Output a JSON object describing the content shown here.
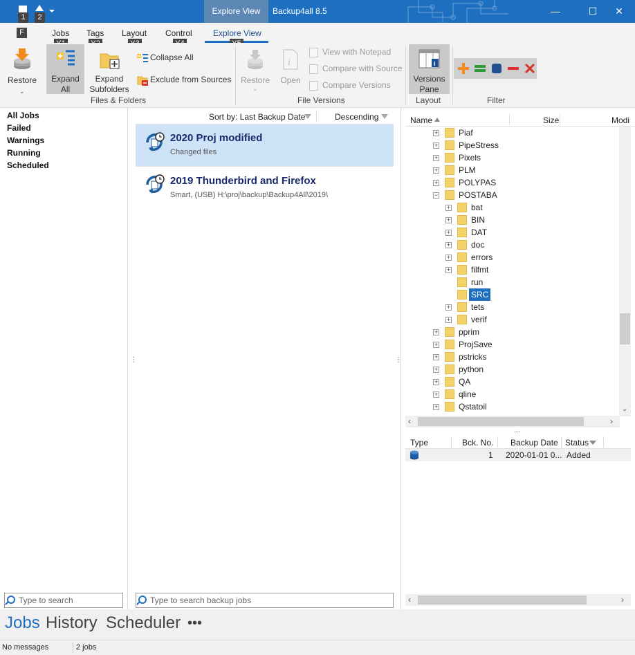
{
  "window": {
    "context_tab": "Explore View",
    "title": "Backup4all 8.5",
    "minimize": "—",
    "maximize": "☐",
    "close": "✕"
  },
  "quick_access": {
    "keytips": [
      "1",
      "2"
    ]
  },
  "tabs": [
    {
      "label": "F",
      "keytip": ""
    },
    {
      "label": "Jobs",
      "keytip": "Y1"
    },
    {
      "label": "Tags",
      "keytip": "Y2"
    },
    {
      "label": "Layout",
      "keytip": "Y3"
    },
    {
      "label": "Control",
      "keytip": "Y4"
    },
    {
      "label": "Explore View",
      "keytip": "Y5"
    }
  ],
  "ribbon": {
    "restore": "Restore",
    "expand_all_1": "Expand",
    "expand_all_2": "All",
    "expand_subfolders_1": "Expand",
    "expand_subfolders_2": "Subfolders",
    "collapse_all": "Collapse All",
    "exclude_from_sources": "Exclude from Sources",
    "group_files_folders": "Files & Folders",
    "fv_restore": "Restore",
    "fv_open": "Open",
    "view_notepad": "View with Notepad",
    "compare_source": "Compare with Source",
    "compare_versions": "Compare Versions",
    "group_file_versions": "File Versions",
    "versions_pane_1": "Versions",
    "versions_pane_2": "Pane",
    "group_layout": "Layout",
    "group_filter": "Filter"
  },
  "nav": {
    "items": [
      "All Jobs",
      "Failed",
      "Warnings",
      "Running",
      "Scheduled"
    ],
    "search_placeholder": "Type to search"
  },
  "jobs": {
    "sort_label": "Sort by: Last Backup Date",
    "order_label": "Descending",
    "list": [
      {
        "title": "2020 Proj modified",
        "subtitle": "Changed files"
      },
      {
        "title": "2019 Thunderbird and Firefox",
        "subtitle": "Smart, (USB) H:\\proj\\backup\\Backup4All\\2019\\"
      }
    ],
    "search_placeholder": "Type to search backup jobs"
  },
  "tree": {
    "columns": [
      "Name",
      "Size",
      "Modi"
    ],
    "rows": [
      {
        "label": "Piaf",
        "level": 0,
        "expander": "+"
      },
      {
        "label": "PipeStress",
        "level": 0,
        "expander": "+"
      },
      {
        "label": "Pixels",
        "level": 0,
        "expander": "+"
      },
      {
        "label": "PLM",
        "level": 0,
        "expander": "+"
      },
      {
        "label": "POLYPAS",
        "level": 0,
        "expander": "+"
      },
      {
        "label": "POSTABA",
        "level": 0,
        "expander": "−"
      },
      {
        "label": "bat",
        "level": 1,
        "expander": "+"
      },
      {
        "label": "BIN",
        "level": 1,
        "expander": "+"
      },
      {
        "label": "DAT",
        "level": 1,
        "expander": "+"
      },
      {
        "label": "doc",
        "level": 1,
        "expander": "+"
      },
      {
        "label": "errors",
        "level": 1,
        "expander": "+"
      },
      {
        "label": "filfmt",
        "level": 1,
        "expander": "+"
      },
      {
        "label": "run",
        "level": 1,
        "expander": ""
      },
      {
        "label": "SRC",
        "level": 1,
        "expander": "",
        "selected": true
      },
      {
        "label": "tets",
        "level": 1,
        "expander": "+"
      },
      {
        "label": "verif",
        "level": 1,
        "expander": "+"
      },
      {
        "label": "pprim",
        "level": 0,
        "expander": "+"
      },
      {
        "label": "ProjSave",
        "level": 0,
        "expander": "+"
      },
      {
        "label": "pstricks",
        "level": 0,
        "expander": "+"
      },
      {
        "label": "python",
        "level": 0,
        "expander": "+"
      },
      {
        "label": "QA",
        "level": 0,
        "expander": "+"
      },
      {
        "label": "qline",
        "level": 0,
        "expander": "+"
      },
      {
        "label": "Qstatoil",
        "level": 0,
        "expander": "+"
      }
    ]
  },
  "versions": {
    "splitter": "...",
    "columns": [
      "Type",
      "Bck. No.",
      "Backup Date",
      "Status"
    ],
    "rows": [
      {
        "bck_no": "1",
        "date": "2020-01-01 0...",
        "status": "Added"
      }
    ]
  },
  "bottom_tabs": [
    "Jobs",
    "History",
    "Scheduler",
    "•••"
  ],
  "status": {
    "messages": "No messages",
    "jobs": "2 jobs"
  },
  "colors": {
    "accent": "#1f6fc1",
    "selection": "#cfe3f8",
    "selected_node": "#1f6fc1"
  }
}
